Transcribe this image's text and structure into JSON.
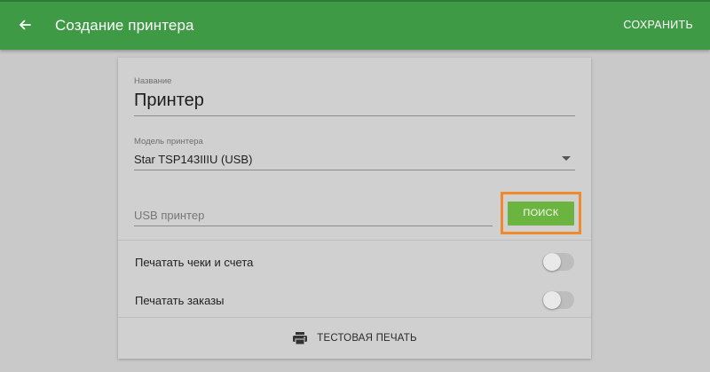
{
  "appbar": {
    "back_icon": "arrow-left-icon",
    "title": "Создание принтера",
    "save_label": "СОХРАНИТЬ",
    "color": "#3f9a45"
  },
  "form": {
    "name_label": "Название",
    "name_value": "Принтер",
    "model_label": "Модель принтера",
    "model_value": "Star TSP143IIIU (USB)",
    "usb_placeholder": "USB принтер",
    "search_label": "ПОИСК",
    "search_color": "#6ab43f",
    "highlight_color": "#f08a2c"
  },
  "toggles": [
    {
      "label": "Печатать чеки и счета",
      "on": false
    },
    {
      "label": "Печатать заказы",
      "on": false
    }
  ],
  "footer": {
    "test_print_icon": "printer-icon",
    "test_print_label": "ТЕСТОВАЯ ПЕЧАТЬ"
  }
}
